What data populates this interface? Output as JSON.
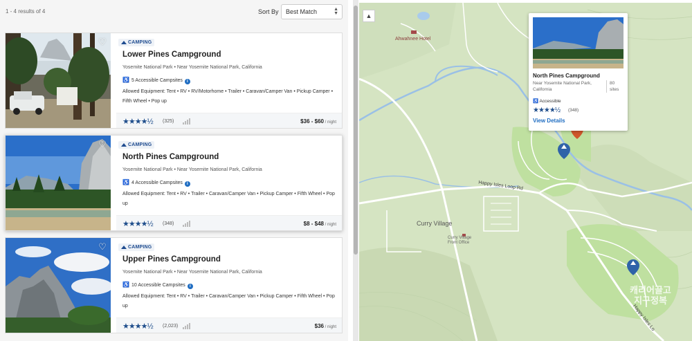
{
  "results": {
    "count_text": "1 - 4 results of 4"
  },
  "sort": {
    "label": "Sort By",
    "value": "Best Match"
  },
  "campgrounds": [
    {
      "badge": "CAMPING",
      "name": "Lower Pines Campground",
      "location": "Yosemite National Park • Near Yosemite National Park, California",
      "accessible": "5 Accessible Campsites",
      "equipment": "Allowed Equipment: Tent • RV • RV/Motorhome • Trailer • Caravan/Camper Van • Pickup Camper • Fifth Wheel • Pop up",
      "stars": "★★★★½",
      "reviews": "(325)",
      "price": "$36 - $60",
      "price_unit": " / night"
    },
    {
      "badge": "CAMPING",
      "name": "North Pines Campground",
      "location": "Yosemite National Park • Near Yosemite National Park, California",
      "accessible": "4 Accessible Campsites",
      "equipment": "Allowed Equipment: Tent • RV • Trailer • Caravan/Camper Van • Pickup Camper • Fifth Wheel • Pop up",
      "stars": "★★★★½",
      "reviews": "(348)",
      "price": "$8 - $48",
      "price_unit": " / night"
    },
    {
      "badge": "CAMPING",
      "name": "Upper Pines Campground",
      "location": "Yosemite National Park • Near Yosemite National Park, California",
      "accessible": "10 Accessible Campsites",
      "equipment": "Allowed Equipment: Tent • RV • Trailer • Caravan/Camper Van • Pickup Camper • Fifth Wheel • Pop up",
      "stars": "★★★★½",
      "reviews": "(2,023)",
      "price": "$36",
      "price_unit": " / night"
    }
  ],
  "map": {
    "labels": {
      "ahwahnee": "Ahwahnee Hotel",
      "curry": "Curry Village",
      "curry_office": "Curry Village Front Office",
      "happy_isles": "Happy Isles Loop Rd",
      "happy_isles_2": "Happy Isles Lo"
    },
    "popup": {
      "name": "North Pines Campground",
      "location": "Near Yosemite National Park, California",
      "sites": "80 sites",
      "accessible": "Accessible",
      "stars": "★★★★½",
      "reviews": "(348)",
      "link": "View Details"
    },
    "watermark": "캐리어끌고 지구정복",
    "colors": {
      "pin_blue": "#2f63a8",
      "pin_red": "#d0562b",
      "campground_fill": "#bfe0a0"
    }
  }
}
